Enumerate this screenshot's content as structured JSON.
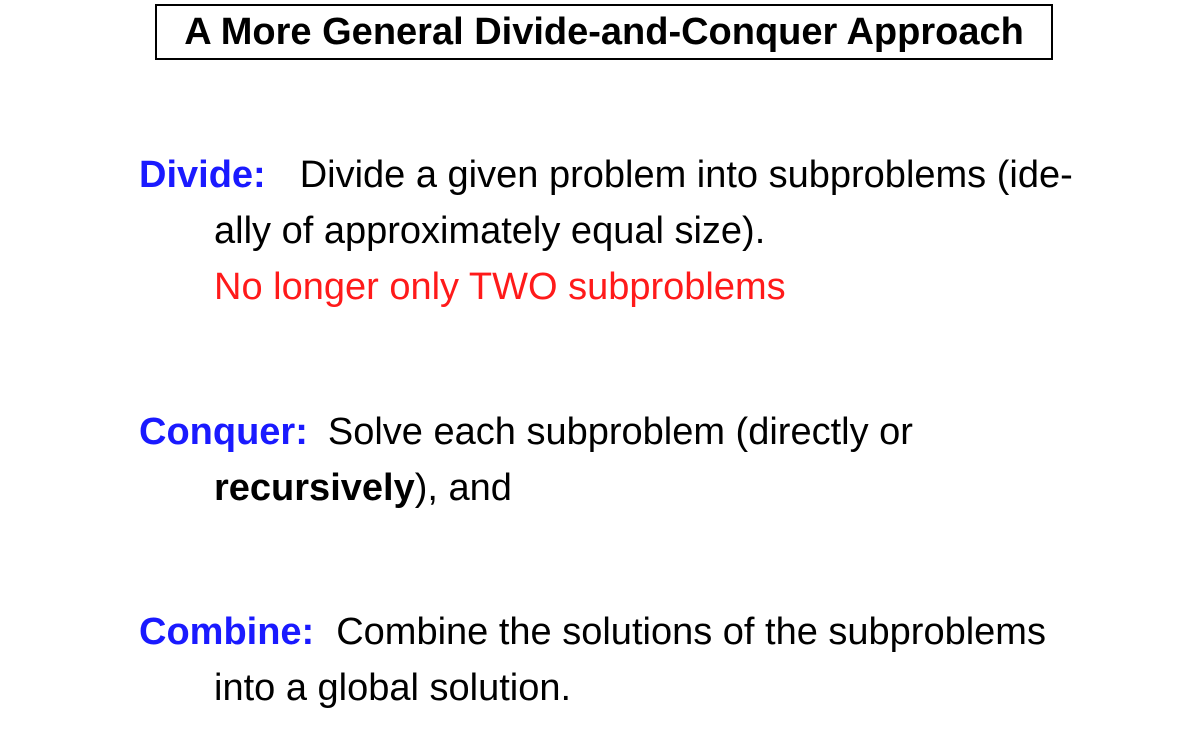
{
  "title": "A More General Divide-and-Conquer Approach",
  "colors": {
    "term": "#1a1aff",
    "note": "#ff1a1a",
    "text": "#000000"
  },
  "divide": {
    "term": "Divide:",
    "line1": "Divide a given problem into subproblems (ide-",
    "line2": "ally of approximately equal size).",
    "note": "No longer only TWO subproblems"
  },
  "conquer": {
    "term": "Conquer:",
    "line1": "Solve each subproblem (directly or",
    "line2_bold": "recursively",
    "line2_rest": "), and"
  },
  "combine": {
    "term": "Combine:",
    "line1": "Combine the solutions of the subproblems",
    "line2": "into a global solution."
  }
}
